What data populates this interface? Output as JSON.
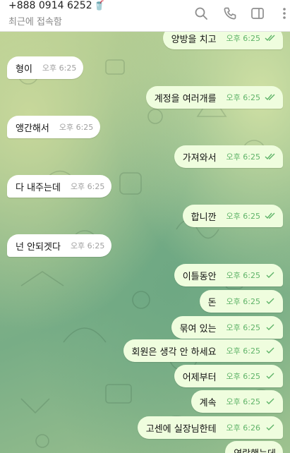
{
  "header": {
    "contact_name": "+888 0914 6252",
    "status": "최근에 접속함",
    "icons": [
      "search-icon",
      "phone-icon",
      "sidebar-toggle-icon",
      "more-vertical-icon"
    ]
  },
  "colors": {
    "incoming_bubble": "#ffffff",
    "outgoing_bubble": "#effdde",
    "outgoing_time": "#5fb368",
    "incoming_time": "#a0a0a0"
  },
  "messages": [
    {
      "dir": "out",
      "text": "양방을 치고",
      "time": "오후 6:25",
      "status": "read"
    },
    {
      "dir": "in",
      "text": "형이",
      "time": "오후 6:25"
    },
    {
      "dir": "out",
      "text": "계정을 여러개를",
      "time": "오후 6:25",
      "status": "read"
    },
    {
      "dir": "in",
      "text": "앵간해서",
      "time": "오후 6:25"
    },
    {
      "dir": "out",
      "text": "가져와서",
      "time": "오후 6:25",
      "status": "read"
    },
    {
      "dir": "in",
      "text": "다 내주는데",
      "time": "오후 6:25"
    },
    {
      "dir": "out",
      "text": "합니깐",
      "time": "오후 6:25",
      "status": "read"
    },
    {
      "dir": "in",
      "text": "넌 안되겟다",
      "time": "오후 6:25"
    },
    {
      "dir": "out",
      "text": "이틀동안",
      "time": "오후 6:25",
      "status": "sent"
    },
    {
      "dir": "out",
      "text": "돈",
      "time": "오후 6:25",
      "status": "sent"
    },
    {
      "dir": "out",
      "text": "묶여 있는",
      "time": "오후 6:25",
      "status": "sent"
    },
    {
      "dir": "out",
      "text": "회원은 생각 안 하세요",
      "time": "오후 6:25",
      "status": "sent"
    },
    {
      "dir": "out",
      "text": "어제부터",
      "time": "오후 6:25",
      "status": "sent"
    },
    {
      "dir": "out",
      "text": "계속",
      "time": "오후 6:25",
      "status": "sent"
    },
    {
      "dir": "out",
      "text": "고센에 실장님한테",
      "time": "오후 6:26",
      "status": "sent"
    },
    {
      "dir": "out",
      "text": "연락했는데",
      "time": "",
      "status": "sent"
    }
  ]
}
